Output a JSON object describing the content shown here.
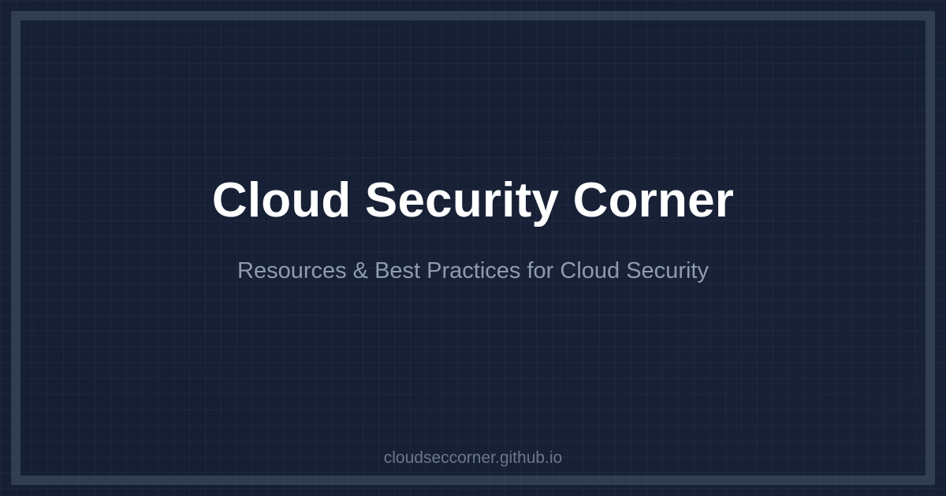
{
  "card": {
    "title": "Cloud Security Corner",
    "subtitle": "Resources & Best Practices for Cloud Security",
    "url": "cloudseccorner.github.io"
  },
  "colors": {
    "background": "#172035",
    "frame": "#475569",
    "title": "#ffffff",
    "subtitle": "#8e9bb0",
    "url": "#6b778c"
  }
}
